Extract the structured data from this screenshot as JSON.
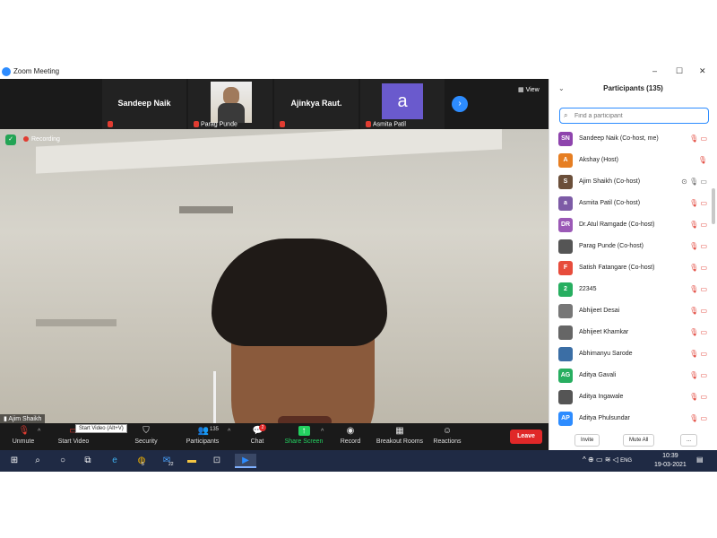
{
  "window": {
    "title": "Zoom Meeting",
    "controls": [
      "–",
      "☐",
      "✕"
    ]
  },
  "strip": {
    "tiles": [
      {
        "name": "Sandeep Naik",
        "label": ""
      },
      {
        "name": "",
        "label": "Parag Punde"
      },
      {
        "name": "Ajinkya Raut.",
        "label": ""
      },
      {
        "name": "a",
        "label": "Asmita Patil"
      }
    ],
    "view_label": "View"
  },
  "video": {
    "recording_label": "Recording",
    "speaker_name": "Ajim Shaikh"
  },
  "toolbar": {
    "unmute": "Unmute",
    "start_video": "Start Video",
    "tooltip": "Start Video (Alt+V)",
    "security": "Security",
    "participants": "Participants",
    "participants_count": "135",
    "chat": "Chat",
    "chat_badge": "2",
    "share_screen": "Share Screen",
    "record": "Record",
    "breakout": "Breakout Rooms",
    "reactions": "Reactions",
    "leave": "Leave"
  },
  "panel": {
    "title": "Participants (135)",
    "search_placeholder": "Find a participant",
    "participants": [
      {
        "initials": "SN",
        "name": "Sandeep Naik (Co-host, me)",
        "color": "#8e44ad"
      },
      {
        "initials": "A",
        "name": "Akshay (Host)",
        "color": "#e67e22"
      },
      {
        "initials": "S",
        "name": "Ajim Shaikh (Co-host)",
        "color": "#6b4f3a"
      },
      {
        "initials": "a",
        "name": "Asmita Patil (Co-host)",
        "color": "#7d5ba6"
      },
      {
        "initials": "DR",
        "name": "Dr.Atul Ramgade (Co-host)",
        "color": "#9b59b6"
      },
      {
        "initials": "",
        "name": "Parag Punde (Co-host)",
        "color": "#555555"
      },
      {
        "initials": "F",
        "name": "Satish Fatangare (Co-host)",
        "color": "#e74c3c"
      },
      {
        "initials": "2",
        "name": "22345",
        "color": "#27ae60"
      },
      {
        "initials": "",
        "name": "Abhijeet Desai",
        "color": "#777777"
      },
      {
        "initials": "",
        "name": "Abhijeet Khamkar",
        "color": "#666666"
      },
      {
        "initials": "",
        "name": "Abhimanyu Sarode",
        "color": "#3b6ea5"
      },
      {
        "initials": "AG",
        "name": "Aditya Gavali",
        "color": "#27ae60"
      },
      {
        "initials": "",
        "name": "Aditya Ingawale",
        "color": "#555555"
      },
      {
        "initials": "AP",
        "name": "Aditya Phulsundar",
        "color": "#2d8cff"
      }
    ],
    "invite": "Invite",
    "mute_all": "Mute All",
    "more": "..."
  },
  "taskbar": {
    "lang": "ENG",
    "time": "10:39",
    "date": "19-03-2021",
    "badge_chrome": "5",
    "badge_mail": "22",
    "notif_count": "5"
  }
}
